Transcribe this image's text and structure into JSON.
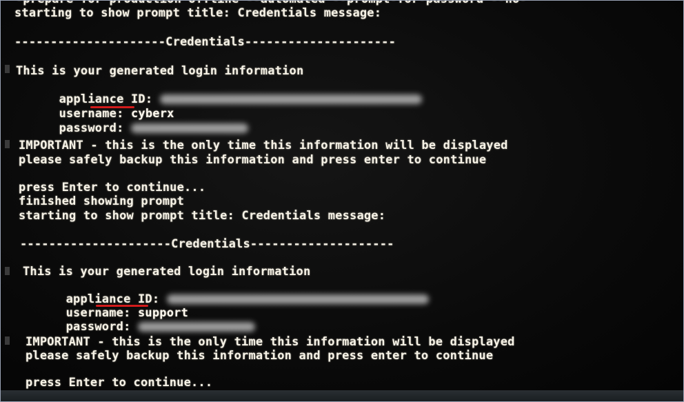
{
  "terminal": {
    "lines": {
      "l0": "-prepare for production offline --automated --prompt-for-password --no-",
      "l1": "starting to show prompt title: Credentials message:",
      "l2": "---------------------Credentials---------------------",
      "l3": "This is your generated login information",
      "l4_label": "appliance ID: ",
      "l5_label": "username: ",
      "l5_value": "cyberx",
      "l6_label": "password: ",
      "l7": "IMPORTANT - this is the only time this information will be displayed",
      "l8": "please safely backup this information and press enter to continue",
      "l9": "press Enter to continue...",
      "l10": "finished showing prompt",
      "l11": "starting to show prompt title: Credentials message:",
      "l12": "---------------------Credentials--------------------",
      "l13": "This is your generated login information",
      "l14_label": "appliance ID: ",
      "l15_label": "username: ",
      "l15_value": "support",
      "l16_label": "password: ",
      "l17": "IMPORTANT - this is the only time this information will be displayed",
      "l18": "please safely backup this information and press enter to continue",
      "l19": "press Enter to continue..."
    }
  },
  "colors": {
    "background": "#070707",
    "text": "#f6f2e6",
    "highlight_underline": "#d21b1b"
  }
}
